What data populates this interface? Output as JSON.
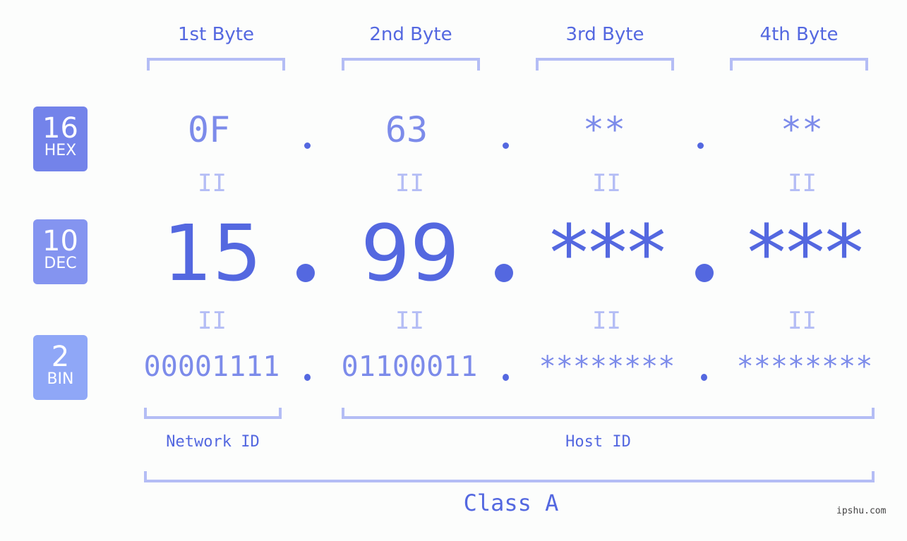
{
  "bytes": [
    {
      "label": "1st Byte",
      "hex": "0F",
      "dec": "15",
      "bin": "00001111"
    },
    {
      "label": "2nd Byte",
      "hex": "63",
      "dec": "99",
      "bin": "01100011"
    },
    {
      "label": "3rd Byte",
      "hex": "**",
      "dec": "***",
      "bin": "********"
    },
    {
      "label": "4th Byte",
      "hex": "**",
      "dec": "***",
      "bin": "********"
    }
  ],
  "badges": {
    "hex": {
      "num": "16",
      "label": "HEX",
      "color": "#7383ea"
    },
    "dec": {
      "num": "10",
      "label": "DEC",
      "color": "#8494f0"
    },
    "bin": {
      "num": "2",
      "label": "BIN",
      "color": "#8fa7f7"
    }
  },
  "equals_glyph": "II",
  "network_label": "Network ID",
  "host_label": "Host ID",
  "class_label": "Class A",
  "watermark": "ipshu.com"
}
